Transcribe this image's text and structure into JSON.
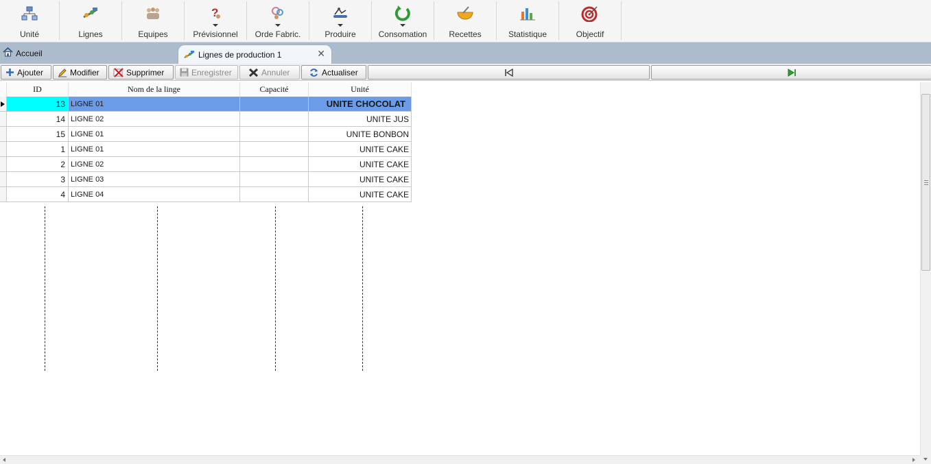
{
  "ribbon": {
    "items": [
      {
        "label": "Unité",
        "icon": "org-chart-icon"
      },
      {
        "label": "Lignes",
        "icon": "production-line-icon"
      },
      {
        "label": "Equipes",
        "icon": "team-icon"
      },
      {
        "label": "Prévisionnel",
        "icon": "question-person-icon"
      },
      {
        "label": "Orde Fabric.",
        "icon": "gears-person-icon"
      },
      {
        "label": "Produire",
        "icon": "conveyor-icon"
      },
      {
        "label": "Consomation",
        "icon": "refresh-circle-icon"
      },
      {
        "label": "Recettes",
        "icon": "mixing-bowl-icon"
      },
      {
        "label": "Statistique",
        "icon": "bar-stats-icon"
      },
      {
        "label": "Objectif",
        "icon": "target-icon"
      }
    ]
  },
  "tabs": {
    "home": "Accueil",
    "active": "Lignes de production 1",
    "close": "✕"
  },
  "toolbar": {
    "add": "Ajouter",
    "edit": "Modifier",
    "delete": "Supprimer",
    "save": "Enregistrer",
    "cancel": "Annuler",
    "refresh": "Actualiser"
  },
  "grid": {
    "columns": {
      "id": "ID",
      "name": "Nom de la linge",
      "capacity": "Capacité",
      "unit": "Unité"
    },
    "rows": [
      {
        "id": "13",
        "name": "LIGNE 01",
        "capacity": "",
        "unit": "UNITE CHOCOLAT"
      },
      {
        "id": "14",
        "name": "LIGNE 02",
        "capacity": "",
        "unit": "UNITE JUS"
      },
      {
        "id": "15",
        "name": "LIGNE 01",
        "capacity": "",
        "unit": "UNITE BONBON"
      },
      {
        "id": "1",
        "name": "LIGNE 01",
        "capacity": "",
        "unit": "UNITE CAKE"
      },
      {
        "id": "2",
        "name": "LIGNE 02",
        "capacity": "",
        "unit": "UNITE CAKE"
      },
      {
        "id": "3",
        "name": "LIGNE 03",
        "capacity": "",
        "unit": "UNITE CAKE"
      },
      {
        "id": "4",
        "name": "LIGNE 04",
        "capacity": "",
        "unit": "UNITE CAKE"
      }
    ]
  },
  "colors": {
    "selected_id_bg": "#00ffff",
    "selected_row_bg": "#6b9ce8",
    "tabbar_bg": "#adbccd"
  }
}
